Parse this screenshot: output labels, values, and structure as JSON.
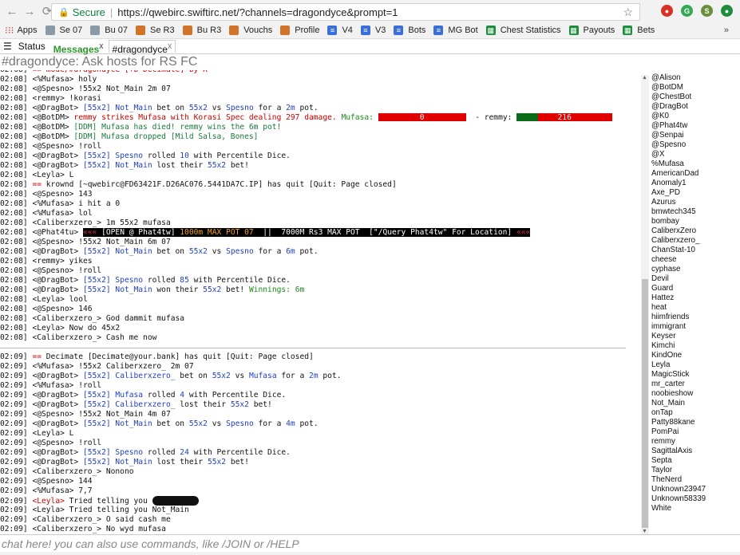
{
  "browser": {
    "secure_label": "Secure",
    "url": "https://qwebirc.swiftirc.net/?channels=dragondyce&prompt=1"
  },
  "bookmarks": [
    "Apps",
    "Se 07",
    "Bu 07",
    "Se R3",
    "Bu R3",
    "Vouchs",
    "Profile",
    "V4",
    "V3",
    "Bots",
    "MG Bot",
    "Chest Statistics",
    "Payouts",
    "Bets"
  ],
  "tabs": {
    "status": "Status",
    "messages": "Messages",
    "messages_close": "X",
    "channel": "#dragondyce",
    "channel_close": "X"
  },
  "channel_title": "#dragondyce: Ask hosts for RS FC",
  "chat": [
    {
      "t": "02:08]",
      "text": "== mode/#dragondyce [+b Decimate] by X",
      "cls": "nick-red",
      "first": true
    },
    {
      "t": "02:08]",
      "text": "<%Mufasa> holy"
    },
    {
      "t": "02:08]",
      "text": "<@Spesno> !55x2 Not_Main 2m 07"
    },
    {
      "t": "02:08]",
      "text": "<remmy> !korasi"
    },
    {
      "t": "02:08]",
      "parts": [
        {
          "s": "<@DragBot> "
        },
        {
          "s": "[55x2] Not_Main",
          "c": "blue"
        },
        {
          "s": " bet on "
        },
        {
          "s": "55x2",
          "c": "blue"
        },
        {
          "s": " vs "
        },
        {
          "s": "Spesno",
          "c": "blue"
        },
        {
          "s": " for a "
        },
        {
          "s": "2m",
          "c": "blue"
        },
        {
          "s": " pot."
        }
      ]
    },
    {
      "t": "02:08]",
      "hp": true
    },
    {
      "t": "02:08]",
      "parts": [
        {
          "s": "<@BotDM> "
        },
        {
          "s": "[DDM] Mufasa has died! remmy wins the 6m pot!",
          "c": "teal"
        }
      ]
    },
    {
      "t": "02:08]",
      "parts": [
        {
          "s": "<@BotDM> "
        },
        {
          "s": "[DDM] Mufasa dropped [Mild Salsa, Bones]",
          "c": "teal"
        }
      ]
    },
    {
      "t": "02:08]",
      "text": "<@Spesno> !roll"
    },
    {
      "t": "02:08]",
      "parts": [
        {
          "s": "<@DragBot> "
        },
        {
          "s": "[55x2] Spesno",
          "c": "blue"
        },
        {
          "s": " rolled "
        },
        {
          "s": "10",
          "c": "blue"
        },
        {
          "s": " with Percentile Dice."
        }
      ]
    },
    {
      "t": "02:08]",
      "parts": [
        {
          "s": "<@DragBot> "
        },
        {
          "s": "[55x2] Not_Main",
          "c": "blue"
        },
        {
          "s": " lost their "
        },
        {
          "s": "55x2",
          "c": "blue"
        },
        {
          "s": " bet!"
        }
      ]
    },
    {
      "t": "02:08]",
      "text": "<Leyla> L"
    },
    {
      "t": "02:08]",
      "parts": [
        {
          "s": "== ",
          "c": "nick-red"
        },
        {
          "s": "krownd [~qwebirc@FD63421F.D26AC076.5441DA7C.IP] has quit [Quit: Page closed]"
        }
      ]
    },
    {
      "t": "02:08]",
      "text": "<@Spesno> 143"
    },
    {
      "t": "02:08]",
      "text": "<%Mufasa> i hit a 0"
    },
    {
      "t": "02:08]",
      "text": "<%Mufasa> lol"
    },
    {
      "t": "02:08]",
      "text": "<Caliberxzero_> 1m 55x2 mufasa"
    },
    {
      "t": "02:08]",
      "banner": true
    },
    {
      "t": "02:08]",
      "text": "<@Spesno> !55x2 Not_Main 6m 07"
    },
    {
      "t": "02:08]",
      "parts": [
        {
          "s": "<@DragBot> "
        },
        {
          "s": "[55x2] Not_Main",
          "c": "blue"
        },
        {
          "s": " bet on "
        },
        {
          "s": "55x2",
          "c": "blue"
        },
        {
          "s": " vs "
        },
        {
          "s": "Spesno",
          "c": "blue"
        },
        {
          "s": " for a "
        },
        {
          "s": "6m",
          "c": "blue"
        },
        {
          "s": " pot."
        }
      ]
    },
    {
      "t": "02:08]",
      "text": "<remmy> yikes"
    },
    {
      "t": "02:08]",
      "text": "<@Spesno> !roll"
    },
    {
      "t": "02:08]",
      "parts": [
        {
          "s": "<@DragBot> "
        },
        {
          "s": "[55x2] Spesno",
          "c": "blue"
        },
        {
          "s": " rolled "
        },
        {
          "s": "85",
          "c": "blue"
        },
        {
          "s": " with Percentile Dice."
        }
      ]
    },
    {
      "t": "02:08]",
      "parts": [
        {
          "s": "<@DragBot> "
        },
        {
          "s": "[55x2] Not_Main",
          "c": "blue"
        },
        {
          "s": " won their "
        },
        {
          "s": "55x2",
          "c": "blue"
        },
        {
          "s": " bet! "
        },
        {
          "s": "Winnings: 6m",
          "c": "green"
        }
      ]
    },
    {
      "t": "02:08]",
      "text": "<Leyla> lool"
    },
    {
      "t": "02:08]",
      "text": "<@Spesno> 146"
    },
    {
      "t": "02:08]",
      "text": "<Caliberxzero_> God dammit mufasa"
    },
    {
      "t": "02:08]",
      "text": "<Leyla> Now do 45x2"
    },
    {
      "t": "02:08]",
      "text": "<Caliberxzero_> Cash me now"
    },
    {
      "divider": true
    },
    {
      "t": "02:09]",
      "parts": [
        {
          "s": "== ",
          "c": "nick-red"
        },
        {
          "s": "Decimate [Decimate@your.bank] has quit [Quit: Page closed]"
        }
      ]
    },
    {
      "t": "02:09]",
      "text": "<%Mufasa> !55x2 Caliberxzero_ 2m 07"
    },
    {
      "t": "02:09]",
      "parts": [
        {
          "s": "<@DragBot> "
        },
        {
          "s": "[55x2] Caliberxzero_",
          "c": "blue"
        },
        {
          "s": " bet on "
        },
        {
          "s": "55x2",
          "c": "blue"
        },
        {
          "s": " vs "
        },
        {
          "s": "Mufasa",
          "c": "blue"
        },
        {
          "s": " for a "
        },
        {
          "s": "2m",
          "c": "blue"
        },
        {
          "s": " pot."
        }
      ]
    },
    {
      "t": "02:09]",
      "text": "<%Mufasa> !roll"
    },
    {
      "t": "02:09]",
      "parts": [
        {
          "s": "<@DragBot> "
        },
        {
          "s": "[55x2] Mufasa",
          "c": "blue"
        },
        {
          "s": " rolled "
        },
        {
          "s": "4",
          "c": "blue"
        },
        {
          "s": " with Percentile Dice."
        }
      ]
    },
    {
      "t": "02:09]",
      "parts": [
        {
          "s": "<@DragBot> "
        },
        {
          "s": "[55x2] Caliberxzero_",
          "c": "blue"
        },
        {
          "s": " lost their "
        },
        {
          "s": "55x2",
          "c": "blue"
        },
        {
          "s": " bet!"
        }
      ]
    },
    {
      "t": "02:09]",
      "text": "<@Spesno> !55x2 Not_Main 4m 07"
    },
    {
      "t": "02:09]",
      "parts": [
        {
          "s": "<@DragBot> "
        },
        {
          "s": "[55x2] Not_Main",
          "c": "blue"
        },
        {
          "s": " bet on "
        },
        {
          "s": "55x2",
          "c": "blue"
        },
        {
          "s": " vs "
        },
        {
          "s": "Spesno",
          "c": "blue"
        },
        {
          "s": " for a "
        },
        {
          "s": "4m",
          "c": "blue"
        },
        {
          "s": " pot."
        }
      ]
    },
    {
      "t": "02:09]",
      "text": "<Leyla> L"
    },
    {
      "t": "02:09]",
      "text": "<@Spesno> !roll"
    },
    {
      "t": "02:09]",
      "parts": [
        {
          "s": "<@DragBot> "
        },
        {
          "s": "[55x2] Spesno",
          "c": "blue"
        },
        {
          "s": " rolled "
        },
        {
          "s": "24",
          "c": "blue"
        },
        {
          "s": " with Percentile Dice."
        }
      ]
    },
    {
      "t": "02:09]",
      "parts": [
        {
          "s": "<@DragBot> "
        },
        {
          "s": "[55x2] Not_Main",
          "c": "blue"
        },
        {
          "s": " lost their "
        },
        {
          "s": "55x2",
          "c": "blue"
        },
        {
          "s": " bet!"
        }
      ]
    },
    {
      "t": "02:09]",
      "text": "<Caliberxzero_> Nonono"
    },
    {
      "t": "02:09]",
      "text": "<@Spesno> 144"
    },
    {
      "t": "02:09]",
      "text": "<%Mufasa> 7,7"
    },
    {
      "t": "02:09]",
      "parts": [
        {
          "s": "<Leyla>",
          "c": "nick-red"
        },
        {
          "s": " Tried telling you "
        }
      ],
      "blur": true
    },
    {
      "t": "02:09]",
      "text": "<Leyla> Tried telling you Not_Main"
    },
    {
      "t": "02:09]",
      "text": "<Caliberxzero_> O said cash me"
    },
    {
      "t": "02:09]",
      "text": "<Caliberxzero_> No wyd mufasa"
    }
  ],
  "hp_line": {
    "prefix": "<@BotDM> ",
    "msg": "remmy strikes Mufasa with Korasi Spec dealing ",
    "damage": "297",
    "msg2": " damage. ",
    "mufasa_label": "Mufasa:",
    "mufasa_hp": "0",
    "mufasa_hp_fraction": 0,
    "remmy_label": "- remmy:",
    "remmy_hp": "216",
    "remmy_hp_fraction": 0.22
  },
  "banner_line": {
    "prefix": "<@Phat4tu> ",
    "arrow_left": "«««",
    "open": " [OPEN @ Phat4tw] ",
    "max1": "1000m MAX POT 07",
    "mid": "  ||  ",
    "max2": "7000M Rs3 MAX POT",
    "query": "  [\"/Query Phat4tw\" For Location] ",
    "arrow_right": "«««"
  },
  "nicklist": [
    "@Alison",
    "@BotDM",
    "@ChestBot",
    "@DragBot",
    "@K0",
    "@Phat4tw",
    "@Senpai",
    "@Spesno",
    "@X",
    "%Mufasa",
    "AmericanDad",
    "Anomaly1",
    "Axe_PD",
    "Azurus",
    "bmwtech345",
    "bombay",
    "CaliberxZero",
    "Caliberxzero_",
    "ChanStat-10",
    "cheese",
    "cyphase",
    "Devil",
    "Guard",
    "Hattez",
    "heat",
    "hiimfriends",
    "immigrant",
    "Keyser",
    "Kimchi",
    "KindOne",
    "Leyla",
    "MagicStick",
    "mr_carter",
    "noobieshow",
    "Not_Main",
    "onTap",
    "Patty88kane",
    "PomPai",
    "remmy",
    "SagittalAxis",
    "Septa",
    "Taylor",
    "TheNerd",
    "Unknown23947",
    "Unknown58339",
    "White"
  ],
  "input": {
    "placeholder": "chat here! you can also use commands, like /JOIN or /HELP"
  }
}
